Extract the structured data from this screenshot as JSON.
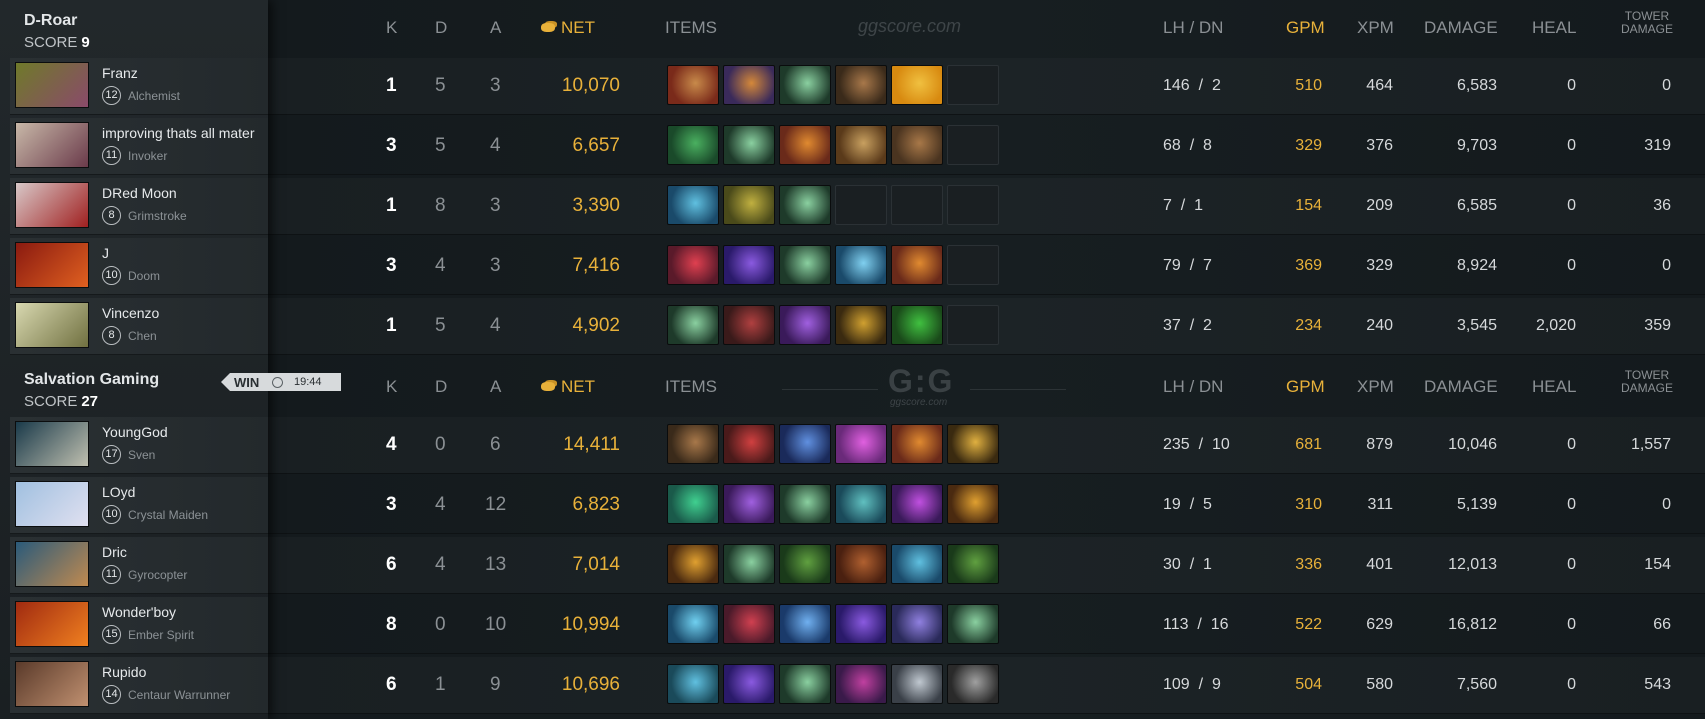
{
  "columns": {
    "k": "K",
    "d": "D",
    "a": "A",
    "net": "NET",
    "items": "ITEMS",
    "lh_dn": "LH  /  DN",
    "gpm": "GPM",
    "xpm": "XPM",
    "damage": "DAMAGE",
    "heal": "HEAL",
    "tower_line1": "TOWER",
    "tower_line2": "DAMAGE"
  },
  "watermark_top": "ggscore.com",
  "watermark_mid_logo": "G:G",
  "watermark_mid_sub": "ggscore.com",
  "match": {
    "result": "WIN",
    "duration": "19:44"
  },
  "teams": [
    {
      "name": "D-Roar",
      "score_label": "SCORE",
      "score": "9",
      "players": [
        {
          "name": "Franz",
          "level": "12",
          "hero": "Alchemist",
          "k": "1",
          "d": "5",
          "a": "3",
          "net": "10,070",
          "lh": "146",
          "dn": "2",
          "gpm": "510",
          "xpm": "464",
          "damage": "6,583",
          "heal": "0",
          "tower": "0",
          "portrait": [
            "#6f7a2a",
            "#8a4a6a"
          ],
          "items": [
            [
              "#7a2a1a",
              "#c88a4a"
            ],
            [
              "#3a2a5a",
              "#d4883a"
            ],
            [
              "#1e3a2a",
              "#8ad0a0"
            ],
            [
              "#3a2a1a",
              "#a8784a"
            ],
            [
              "#d88a10",
              "#f0c040"
            ],
            null
          ]
        },
        {
          "name": "improving thats all mater",
          "level": "11",
          "hero": "Invoker",
          "k": "3",
          "d": "5",
          "a": "4",
          "net": "6,657",
          "lh": "68",
          "dn": "8",
          "gpm": "329",
          "xpm": "376",
          "damage": "9,703",
          "heal": "0",
          "tower": "319",
          "portrait": [
            "#c8b8a8",
            "#6a3a4a"
          ],
          "items": [
            [
              "#1a4a2a",
              "#4ab060"
            ],
            [
              "#1e3a2a",
              "#8ad0a0"
            ],
            [
              "#6a2a1a",
              "#e08a30"
            ],
            [
              "#5a3a1a",
              "#c8a060"
            ],
            [
              "#4a3420",
              "#a87848"
            ],
            null
          ]
        },
        {
          "name": "DRed Moon",
          "level": "8",
          "hero": "Grimstroke",
          "k": "1",
          "d": "8",
          "a": "3",
          "net": "3,390",
          "lh": "7",
          "dn": "1",
          "gpm": "154",
          "xpm": "209",
          "damage": "6,585",
          "heal": "0",
          "tower": "36",
          "portrait": [
            "#d8c8c8",
            "#a02020"
          ],
          "items": [
            [
              "#1a4a6a",
              "#60c0e0"
            ],
            [
              "#4a4a1a",
              "#c0b040"
            ],
            [
              "#1e3a2a",
              "#8ad0a0"
            ],
            null,
            null,
            null
          ]
        },
        {
          "name": "J",
          "level": "10",
          "hero": "Doom",
          "k": "3",
          "d": "4",
          "a": "3",
          "net": "7,416",
          "lh": "79",
          "dn": "7",
          "gpm": "369",
          "xpm": "329",
          "damage": "8,924",
          "heal": "0",
          "tower": "0",
          "portrait": [
            "#8a1a10",
            "#e06020"
          ],
          "items": [
            [
              "#5a1a2a",
              "#e04050"
            ],
            [
              "#2a1a6a",
              "#8a5ae0"
            ],
            [
              "#1e3a2a",
              "#8ad0a0"
            ],
            [
              "#1a4a6a",
              "#80d0f0"
            ],
            [
              "#6a2a1a",
              "#e08a30"
            ],
            null
          ]
        },
        {
          "name": "Vincenzo",
          "level": "8",
          "hero": "Chen",
          "k": "1",
          "d": "5",
          "a": "4",
          "net": "4,902",
          "lh": "37",
          "dn": "2",
          "gpm": "234",
          "xpm": "240",
          "damage": "3,545",
          "heal": "2,020",
          "tower": "359",
          "portrait": [
            "#d8d8b0",
            "#707040"
          ],
          "items": [
            [
              "#1e3a2a",
              "#8ad0a0"
            ],
            [
              "#3a1a1a",
              "#b04040"
            ],
            [
              "#3a1a5a",
              "#a060e0"
            ],
            [
              "#3a2a10",
              "#d0a030"
            ],
            [
              "#1a4a1a",
              "#40c040"
            ],
            null
          ]
        }
      ]
    },
    {
      "name": "Salvation Gaming",
      "score_label": "SCORE",
      "score": "27",
      "players": [
        {
          "name": "YoungGod",
          "level": "17",
          "hero": "Sven",
          "k": "4",
          "d": "0",
          "a": "6",
          "net": "14,411",
          "lh": "235",
          "dn": "10",
          "gpm": "681",
          "xpm": "879",
          "damage": "10,046",
          "heal": "0",
          "tower": "1,557",
          "portrait": [
            "#1a3a4a",
            "#c0c0b0"
          ],
          "items": [
            [
              "#3a2a1a",
              "#a8784a"
            ],
            [
              "#4a1a1a",
              "#d04040"
            ],
            [
              "#1a2a5a",
              "#6090e0"
            ],
            [
              "#6a2a7a",
              "#e060e0"
            ],
            [
              "#6a2a1a",
              "#e08a30"
            ],
            [
              "#3a2a10",
              "#e0b040"
            ]
          ]
        },
        {
          "name": "LOyd",
          "level": "10",
          "hero": "Crystal Maiden",
          "k": "3",
          "d": "4",
          "a": "12",
          "net": "6,823",
          "lh": "19",
          "dn": "5",
          "gpm": "310",
          "xpm": "311",
          "damage": "5,139",
          "heal": "0",
          "tower": "0",
          "portrait": [
            "#a0c0e0",
            "#e0e0f0"
          ],
          "items": [
            [
              "#1a5a4a",
              "#40d090"
            ],
            [
              "#3a1a5a",
              "#a060e0"
            ],
            [
              "#1e3a2a",
              "#8ad0a0"
            ],
            [
              "#1a4a5a",
              "#60c0c0"
            ],
            [
              "#3a1a5a",
              "#c050e0"
            ],
            [
              "#4a2a10",
              "#e0a030"
            ]
          ]
        },
        {
          "name": "Dric",
          "level": "11",
          "hero": "Gyrocopter",
          "k": "6",
          "d": "4",
          "a": "13",
          "net": "7,014",
          "lh": "30",
          "dn": "1",
          "gpm": "336",
          "xpm": "401",
          "damage": "12,013",
          "heal": "0",
          "tower": "154",
          "portrait": [
            "#2a5a7a",
            "#c08a50"
          ],
          "items": [
            [
              "#4a2a10",
              "#e0a030"
            ],
            [
              "#1e3a2a",
              "#8ad0a0"
            ],
            [
              "#1a3a1a",
              "#60a040"
            ],
            [
              "#4a2010",
              "#b06030"
            ],
            [
              "#1a4a6a",
              "#60c0e0"
            ],
            [
              "#1a3a1a",
              "#60a040"
            ]
          ]
        },
        {
          "name": "Wonder'boy",
          "level": "15",
          "hero": "Ember Spirit",
          "k": "8",
          "d": "0",
          "a": "10",
          "net": "10,994",
          "lh": "113",
          "dn": "16",
          "gpm": "522",
          "xpm": "629",
          "damage": "16,812",
          "heal": "0",
          "tower": "66",
          "portrait": [
            "#a02a10",
            "#f08020"
          ],
          "items": [
            [
              "#1a4a6a",
              "#70d0f0"
            ],
            [
              "#4a1a2a",
              "#d04050"
            ],
            [
              "#1a3a6a",
              "#70b0f0"
            ],
            [
              "#2a1a6a",
              "#8a5ae0"
            ],
            [
              "#2a2a5a",
              "#9080e0"
            ],
            [
              "#1e3a2a",
              "#8ad0a0"
            ]
          ]
        },
        {
          "name": "Rupido",
          "level": "14",
          "hero": "Centaur Warrunner",
          "k": "6",
          "d": "1",
          "a": "9",
          "net": "10,696",
          "lh": "109",
          "dn": "9",
          "gpm": "504",
          "xpm": "580",
          "damage": "7,560",
          "heal": "0",
          "tower": "543",
          "portrait": [
            "#5a3a2a",
            "#c09070"
          ],
          "items": [
            [
              "#1a4a5a",
              "#60c0e0"
            ],
            [
              "#2a1a6a",
              "#8a5ae0"
            ],
            [
              "#1e3a2a",
              "#8ad0a0"
            ],
            [
              "#3a1a4a",
              "#c040a0"
            ],
            [
              "#3a4048",
              "#c0c8d0"
            ],
            [
              "#2a2a2a",
              "#a0a0a0"
            ]
          ]
        }
      ]
    }
  ]
}
